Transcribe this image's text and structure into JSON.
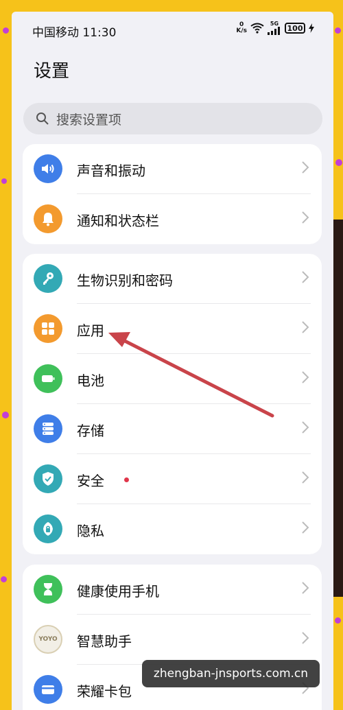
{
  "status_bar": {
    "carrier_time": "中国移动 11:30",
    "net_speed_value": "0",
    "net_speed_unit": "K/s",
    "network": "5G",
    "battery": "100"
  },
  "page_title": "设置",
  "search": {
    "placeholder": "搜索设置项"
  },
  "groups": [
    {
      "items": [
        {
          "label": "声音和振动",
          "icon": "speaker-icon",
          "color": "#3f7ee8"
        },
        {
          "label": "通知和状态栏",
          "icon": "bell-icon",
          "color": "#f39a2e"
        }
      ]
    },
    {
      "items": [
        {
          "label": "生物识别和密码",
          "icon": "key-icon",
          "color": "#33a9b5"
        },
        {
          "label": "应用",
          "icon": "apps-grid-icon",
          "color": "#f39a2e"
        },
        {
          "label": "电池",
          "icon": "battery-icon",
          "color": "#3fc05a"
        },
        {
          "label": "存储",
          "icon": "storage-icon",
          "color": "#3f7ee8"
        },
        {
          "label": "安全",
          "icon": "shield-icon",
          "color": "#33a9b5",
          "badge": "red-dot"
        },
        {
          "label": "隐私",
          "icon": "privacy-lock-icon",
          "color": "#33a9b5"
        }
      ]
    },
    {
      "items": [
        {
          "label": "健康使用手机",
          "icon": "hourglass-icon",
          "color": "#3fc05a"
        },
        {
          "label": "智慧助手",
          "icon": "yoyo-icon",
          "color": "#e9e3d2",
          "icon_text": "YOYO"
        },
        {
          "label": "荣耀卡包",
          "icon": "wallet-card-icon",
          "color": "#3f7ee8"
        }
      ]
    }
  ],
  "watermark": "zhengban-jnsports.com.cn",
  "annotation": {
    "type": "arrow",
    "color": "#c9444a",
    "points_to": "应用"
  }
}
